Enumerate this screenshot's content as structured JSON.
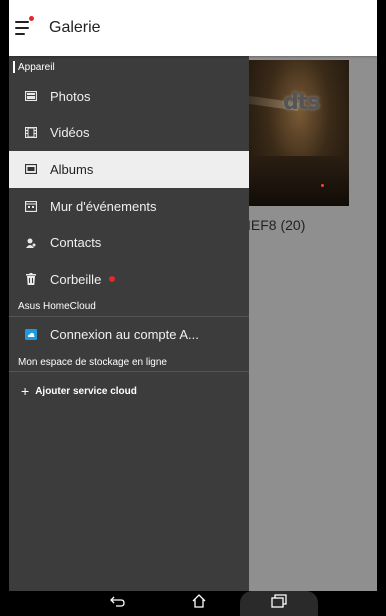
{
  "app_bar": {
    "title": "Galerie"
  },
  "drawer": {
    "section_device": "Appareil",
    "device_items": [
      {
        "label": "Photos",
        "icon": "photos-icon",
        "active": false
      },
      {
        "label": "Vidéos",
        "icon": "film-icon",
        "active": false
      },
      {
        "label": "Albums",
        "icon": "albums-icon",
        "active": true
      },
      {
        "label": "Mur d'événements",
        "icon": "calendar-icon",
        "active": false
      },
      {
        "label": "Contacts",
        "icon": "contacts-icon",
        "active": false
      },
      {
        "label": "Corbeille",
        "icon": "trash-icon",
        "active": false
      }
    ],
    "section_homecloud": "Asus HomeCloud",
    "homecloud_item": "Connexion au compte A...",
    "section_online": "Mon espace de stockage en ligne",
    "add_cloud": "Ajouter service cloud"
  },
  "content": {
    "album_label": "IEF8 (20)",
    "thumb_logo": "dts"
  },
  "colors": {
    "drawer_bg": "#3c3c3c",
    "active_item_bg": "#eeeeee",
    "accent_red": "#e4262d",
    "homecloud_blue": "#1e9be0"
  }
}
